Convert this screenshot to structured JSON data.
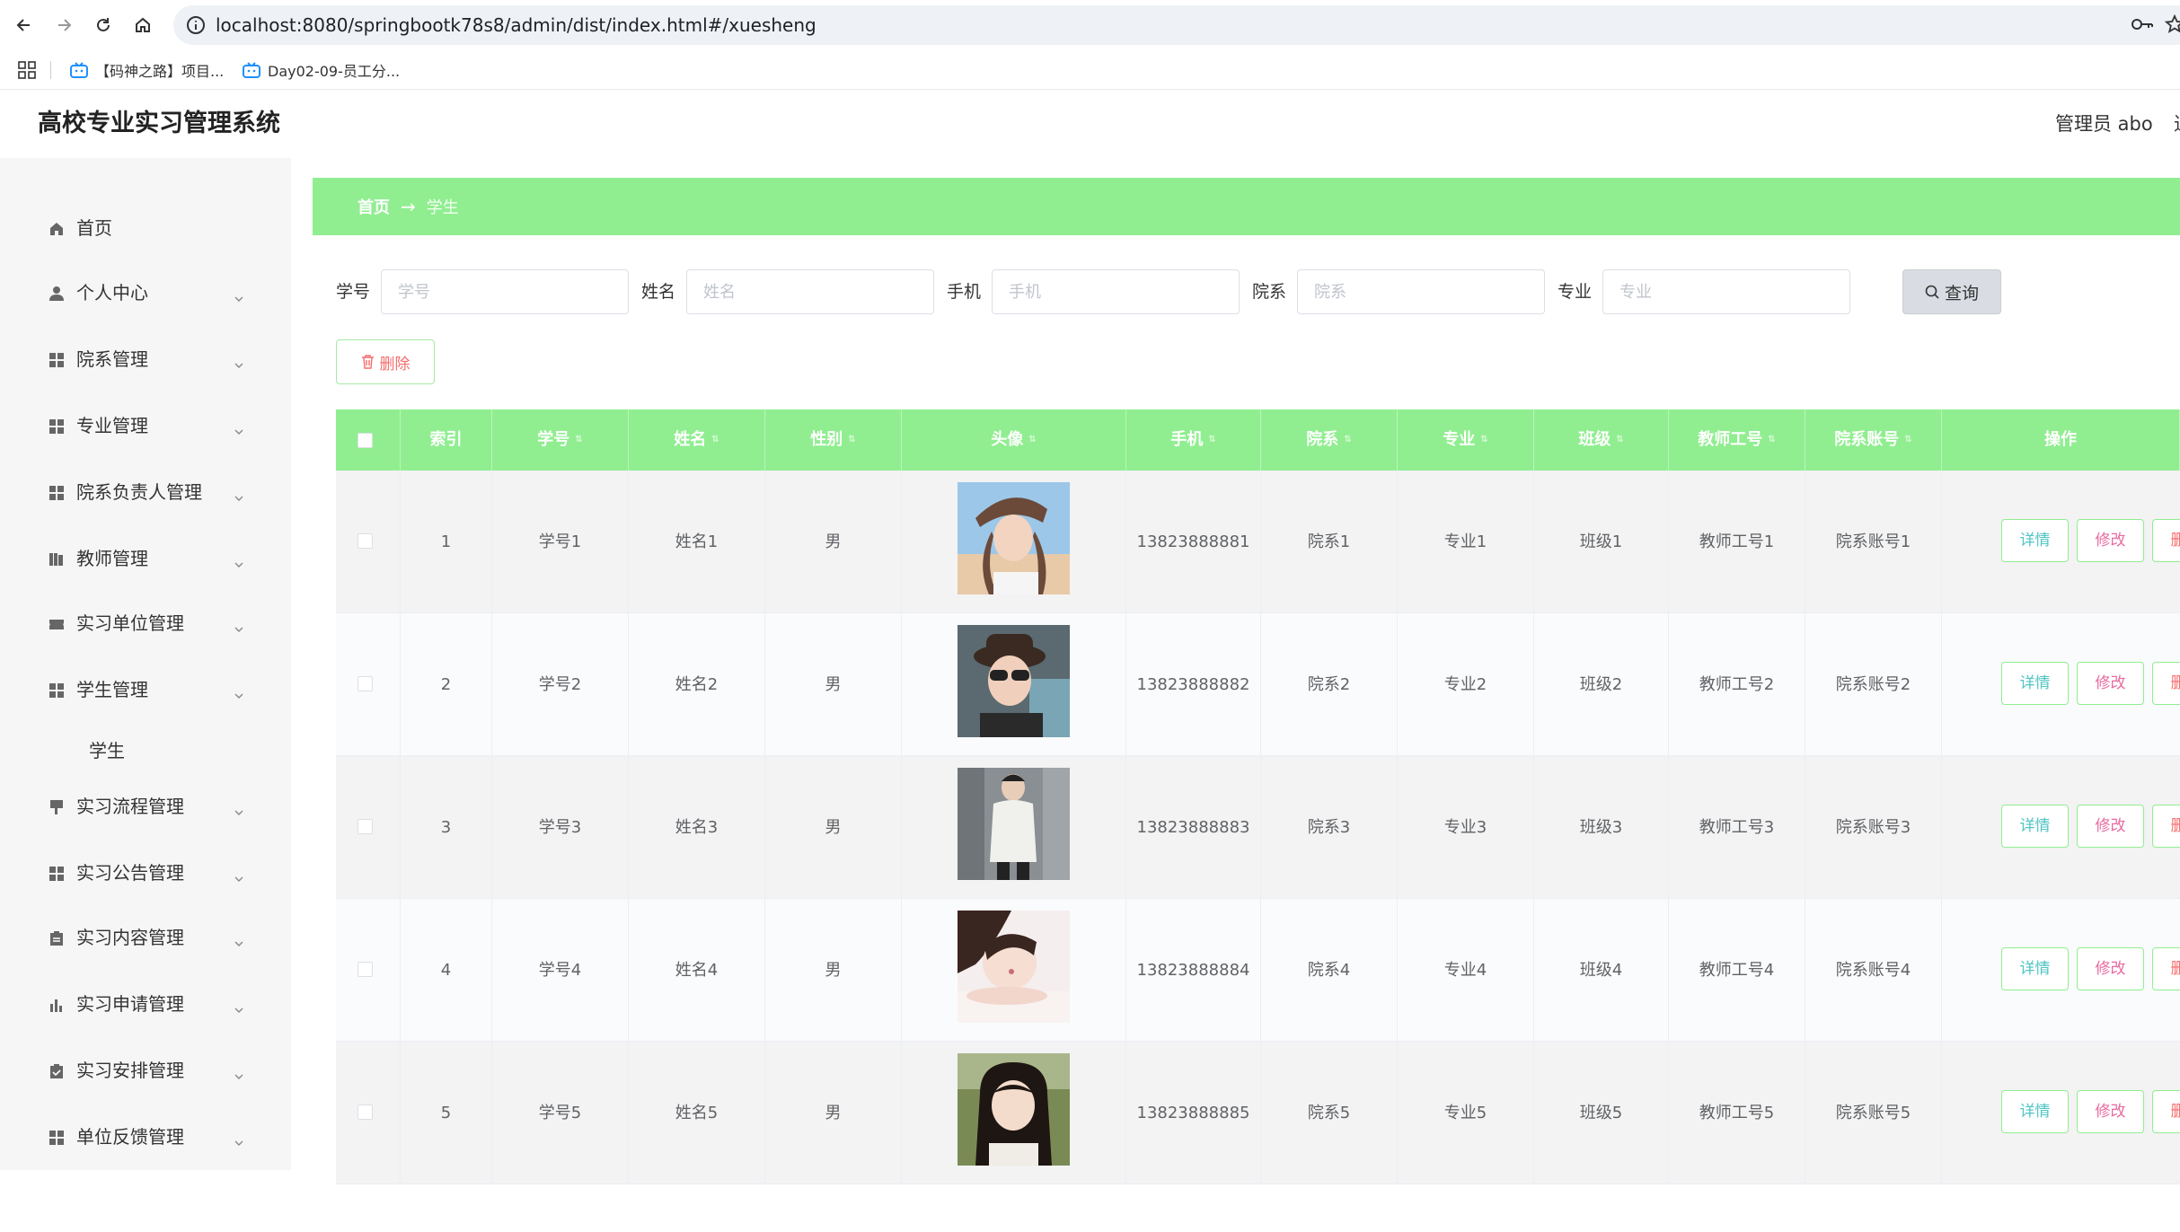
{
  "browser": {
    "url": "localhost:8080/springbootk78s8/admin/dist/index.html#/xuesheng",
    "bookmarks": [
      {
        "label": "【码神之路】项目..."
      },
      {
        "label": "Day02-09-员工分..."
      }
    ]
  },
  "header": {
    "title": "高校专业实习管理系统",
    "user": "管理员 abo",
    "logout_partial": "退"
  },
  "sidebar": {
    "items": [
      {
        "label": "首页",
        "icon": "home-icon"
      },
      {
        "label": "个人中心",
        "icon": "user-icon"
      },
      {
        "label": "院系管理",
        "icon": "grid-icon"
      },
      {
        "label": "专业管理",
        "icon": "grid-icon"
      },
      {
        "label": "院系负责人管理",
        "icon": "grid-icon"
      },
      {
        "label": "教师管理",
        "icon": "book-icon"
      },
      {
        "label": "实习单位管理",
        "icon": "ticket-icon"
      },
      {
        "label": "学生管理",
        "icon": "grid-icon"
      },
      {
        "label": "实习流程管理",
        "icon": "flag-icon"
      },
      {
        "label": "实习公告管理",
        "icon": "grid-icon"
      },
      {
        "label": "实习内容管理",
        "icon": "clipboard-icon"
      },
      {
        "label": "实习申请管理",
        "icon": "bar-chart-icon"
      },
      {
        "label": "实习安排管理",
        "icon": "clipboard-check-icon"
      },
      {
        "label": "单位反馈管理",
        "icon": "grid-icon"
      }
    ],
    "sub_item": "学生"
  },
  "breadcrumb": {
    "home": "首页",
    "arrow": "→",
    "current": "学生"
  },
  "search": {
    "fields": [
      {
        "label": "学号",
        "placeholder": "学号"
      },
      {
        "label": "姓名",
        "placeholder": "姓名"
      },
      {
        "label": "手机",
        "placeholder": "手机"
      },
      {
        "label": "院系",
        "placeholder": "院系"
      },
      {
        "label": "专业",
        "placeholder": "专业"
      }
    ],
    "query_label": "查询"
  },
  "batch_delete_label": "删除",
  "table": {
    "columns": [
      "",
      "索引",
      "学号",
      "姓名",
      "性别",
      "头像",
      "手机",
      "院系",
      "专业",
      "班级",
      "教师工号",
      "院系账号",
      "操作"
    ],
    "rows": [
      {
        "index": "1",
        "xuehao": "学号1",
        "name": "姓名1",
        "gender": "男",
        "phone": "13823888881",
        "dept": "院系1",
        "major": "专业1",
        "class": "班级1",
        "teacher": "教师工号1",
        "account": "院系账号1"
      },
      {
        "index": "2",
        "xuehao": "学号2",
        "name": "姓名2",
        "gender": "男",
        "phone": "13823888882",
        "dept": "院系2",
        "major": "专业2",
        "class": "班级2",
        "teacher": "教师工号2",
        "account": "院系账号2"
      },
      {
        "index": "3",
        "xuehao": "学号3",
        "name": "姓名3",
        "gender": "男",
        "phone": "13823888883",
        "dept": "院系3",
        "major": "专业3",
        "class": "班级3",
        "teacher": "教师工号3",
        "account": "院系账号3"
      },
      {
        "index": "4",
        "xuehao": "学号4",
        "name": "姓名4",
        "gender": "男",
        "phone": "13823888884",
        "dept": "院系4",
        "major": "专业4",
        "class": "班级4",
        "teacher": "教师工号4",
        "account": "院系账号4"
      },
      {
        "index": "5",
        "xuehao": "学号5",
        "name": "姓名5",
        "gender": "男",
        "phone": "13823888885",
        "dept": "院系5",
        "major": "专业5",
        "class": "班级5",
        "teacher": "教师工号5",
        "account": "院系账号5"
      }
    ],
    "actions": {
      "detail": "详情",
      "edit": "修改",
      "delete": "删除"
    }
  },
  "colors": {
    "accent": "#90ee90",
    "danger": "#f56c6c",
    "sidebar_bg": "#f6f6f6"
  }
}
